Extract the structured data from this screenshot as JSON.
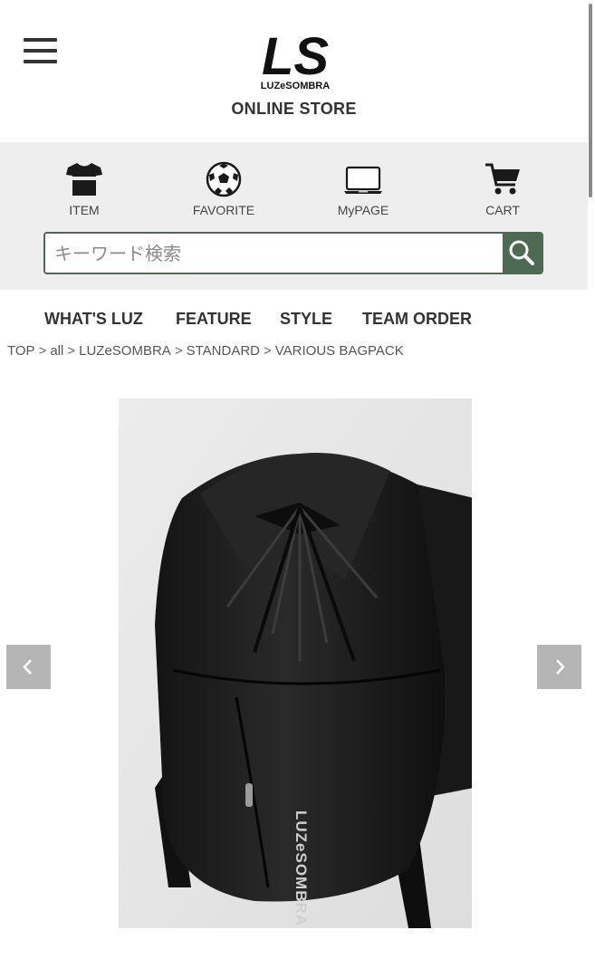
{
  "brand": {
    "logo_text": "LS",
    "logo_subtext": "LUZeSOMBRA",
    "store_label": "ONLINE STORE"
  },
  "icon_nav": [
    {
      "label": "ITEM",
      "icon": "t-shirt-icon"
    },
    {
      "label": "FAVORITE",
      "icon": "soccer-ball-icon"
    },
    {
      "label": "MyPAGE",
      "icon": "laptop-icon"
    },
    {
      "label": "CART",
      "icon": "cart-icon"
    }
  ],
  "search": {
    "placeholder": "キーワード検索",
    "value": "",
    "button_icon": "search-icon"
  },
  "main_nav": [
    "WHAT'S LUZ",
    "FEATURE",
    "STYLE",
    "TEAM ORDER"
  ],
  "breadcrumb": [
    "TOP",
    "all",
    "LUZeSOMBRA",
    "STANDARD",
    "VARIOUS BAGPACK"
  ],
  "breadcrumb_separator": ">",
  "product_image": {
    "print_text": "LUZeSOMBRA",
    "prev_icon": "chevron-left-icon",
    "next_icon": "chevron-right-icon"
  },
  "colors": {
    "accent_green": "#4d6b52",
    "band_gray": "#eeeeee",
    "arrow_gray": "#b5b5b5",
    "text": "#333333"
  }
}
